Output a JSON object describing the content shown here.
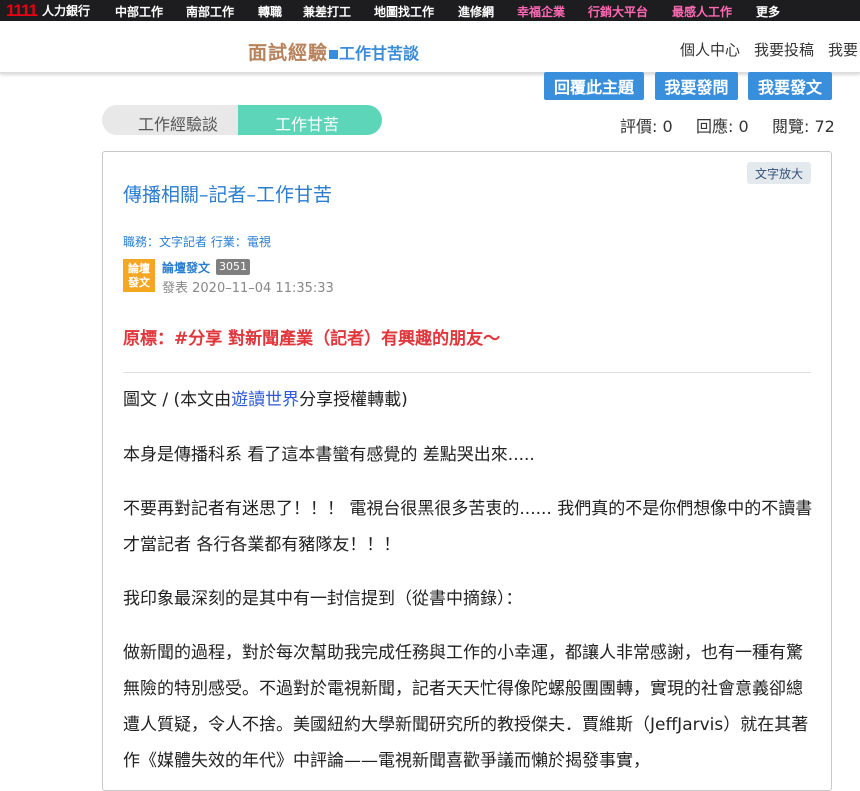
{
  "topnav": {
    "brand_num": "1111",
    "brand_text": "人力銀行",
    "items": [
      "中部工作",
      "南部工作",
      "轉職",
      "兼差打工",
      "地圖找工作",
      "進修網",
      "幸福企業",
      "行銷大平台",
      "最感人工作",
      "更多"
    ]
  },
  "header": {
    "logo_a": "面試經驗",
    "logo_b": "工作甘苦談",
    "links": [
      "個人中心",
      "我要投稿",
      "我要"
    ]
  },
  "actions": [
    "回覆此主題",
    "我要發問",
    "我要發文"
  ],
  "breadcrumb": [
    "工作經驗談",
    "工作甘苦"
  ],
  "stats": {
    "rating": "評價: 0",
    "replies": "回應: 0",
    "views": "閱覽: 72"
  },
  "article": {
    "zoom_label": "文字放大",
    "title": "傳播相關–記者–工作甘苦",
    "meta": "職務：文字記者   行業：電視",
    "avatar_top": "論壇",
    "avatar_bottom": "發文",
    "author": "論壇發文",
    "author_count": "3051",
    "posted": "發表 2020–11–04 11:35:33",
    "original_title": "原標：#分享 對新聞產業（記者）有興趣的朋友～",
    "credit_pre": "圖文 / (本文由",
    "credit_link": "遊讀世界",
    "credit_post": "分享授權轉載)",
    "p1": "本身是傳播科系 看了這本書蠻有感覺的 差點哭出來.....",
    "p2": "不要再對記者有迷思了！！！ 電視台很黑很多苦衷的...... 我們真的不是你們想像中的不讀書才當記者 各行各業都有豬隊友！！！",
    "p3": "我印象最深刻的是其中有一封信提到（從書中摘錄）：",
    "p4": "做新聞的過程，對於每次幫助我完成任務與工作的小幸運，都讓人非常感謝，也有一種有驚無險的特別感受。不過對於電視新聞，記者天天忙得像陀螺般團團轉，實現的社會意義卻總遭人質疑，令人不捨。美國紐約大學新聞研究所的教授傑夫．賈維斯（JeffJarvis）就在其著作《媒體失效的年代》中評論——電視新聞喜歡爭議而懶於揭發事實，"
  }
}
